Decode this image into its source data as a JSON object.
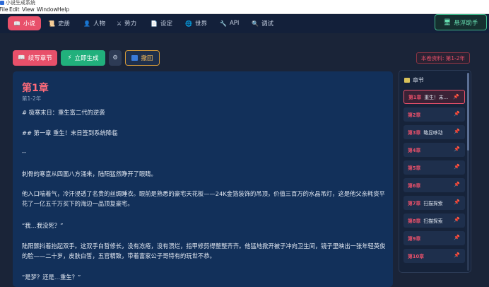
{
  "window": {
    "title": "小说生成系统"
  },
  "menu": [
    "File",
    "Edit",
    "View",
    "Window",
    "Help"
  ],
  "nav": {
    "tabs": [
      {
        "icon": "📖",
        "label": "小说"
      },
      {
        "icon": "📜",
        "label": "史册"
      },
      {
        "icon": "👤",
        "label": "人物"
      },
      {
        "icon": "⚔",
        "label": "势力"
      },
      {
        "icon": "📄",
        "label": "设定"
      },
      {
        "icon": "🌐",
        "label": "世界"
      },
      {
        "icon": "🔧",
        "label": "API"
      },
      {
        "icon": "🔍",
        "label": "调试"
      }
    ],
    "assistant": {
      "icon": "🖥",
      "label": "悬浮助手"
    }
  },
  "toolbar": {
    "continue_label": "续写章节",
    "generate_label": "立即生成",
    "settings_icon": "⚙",
    "undo_label": "撤回",
    "volume_badge": "本卷资料: 第1-2年"
  },
  "editor": {
    "chapter_title": "第1章",
    "chapter_sub": "第1-2年",
    "paragraphs": [
      "# 极寒末日：重生富二代的逆袭",
      "## 第一章 重生！末日签到系统降临",
      "--",
      "刺骨的寒意从四面八方涌来，陆阳猛然睁开了眼睛。",
      "他入口喘着气，冷汗浸透了名贵的丝绸睡衣。眼前是熟悉的豪宅天花板——24K金箔装饰的吊顶，价值三百万的水晶吊灯，这是他父亲耗资平花了一亿五千万买下的海边一品顶复豪宅。",
      "“我…我没死？”",
      "陆阳颤抖着抬起双手。这双手白皙修长，没有冻疮，没有溃烂，指甲修剪得整整齐齐。他猛地掀开被子冲向卫生间，镜子里映出一张年轻英俊的脸——二十岁，皮肤白皙，五官精致，带着富家公子哥特有的玩世不恭。",
      "“是梦？还是…重生？”"
    ]
  },
  "chapters": {
    "header": "章节",
    "items": [
      {
        "num": "第1章",
        "name": "重生！末…"
      },
      {
        "num": "第2章",
        "name": ""
      },
      {
        "num": "第3章",
        "name": "略显哆动"
      },
      {
        "num": "第4章",
        "name": ""
      },
      {
        "num": "第5章",
        "name": ""
      },
      {
        "num": "第6章",
        "name": ""
      },
      {
        "num": "第7章",
        "name": "扫描探索"
      },
      {
        "num": "第8章",
        "name": "扫描探索"
      },
      {
        "num": "第9章",
        "name": ""
      },
      {
        "num": "第10章",
        "name": ""
      }
    ],
    "pin_icon": "📌"
  },
  "colors": {
    "accent": "#e8506a",
    "success": "#21b07c",
    "background": "#1a2438",
    "editor_bg": "#12305a",
    "warning_border": "#d39a3a"
  }
}
